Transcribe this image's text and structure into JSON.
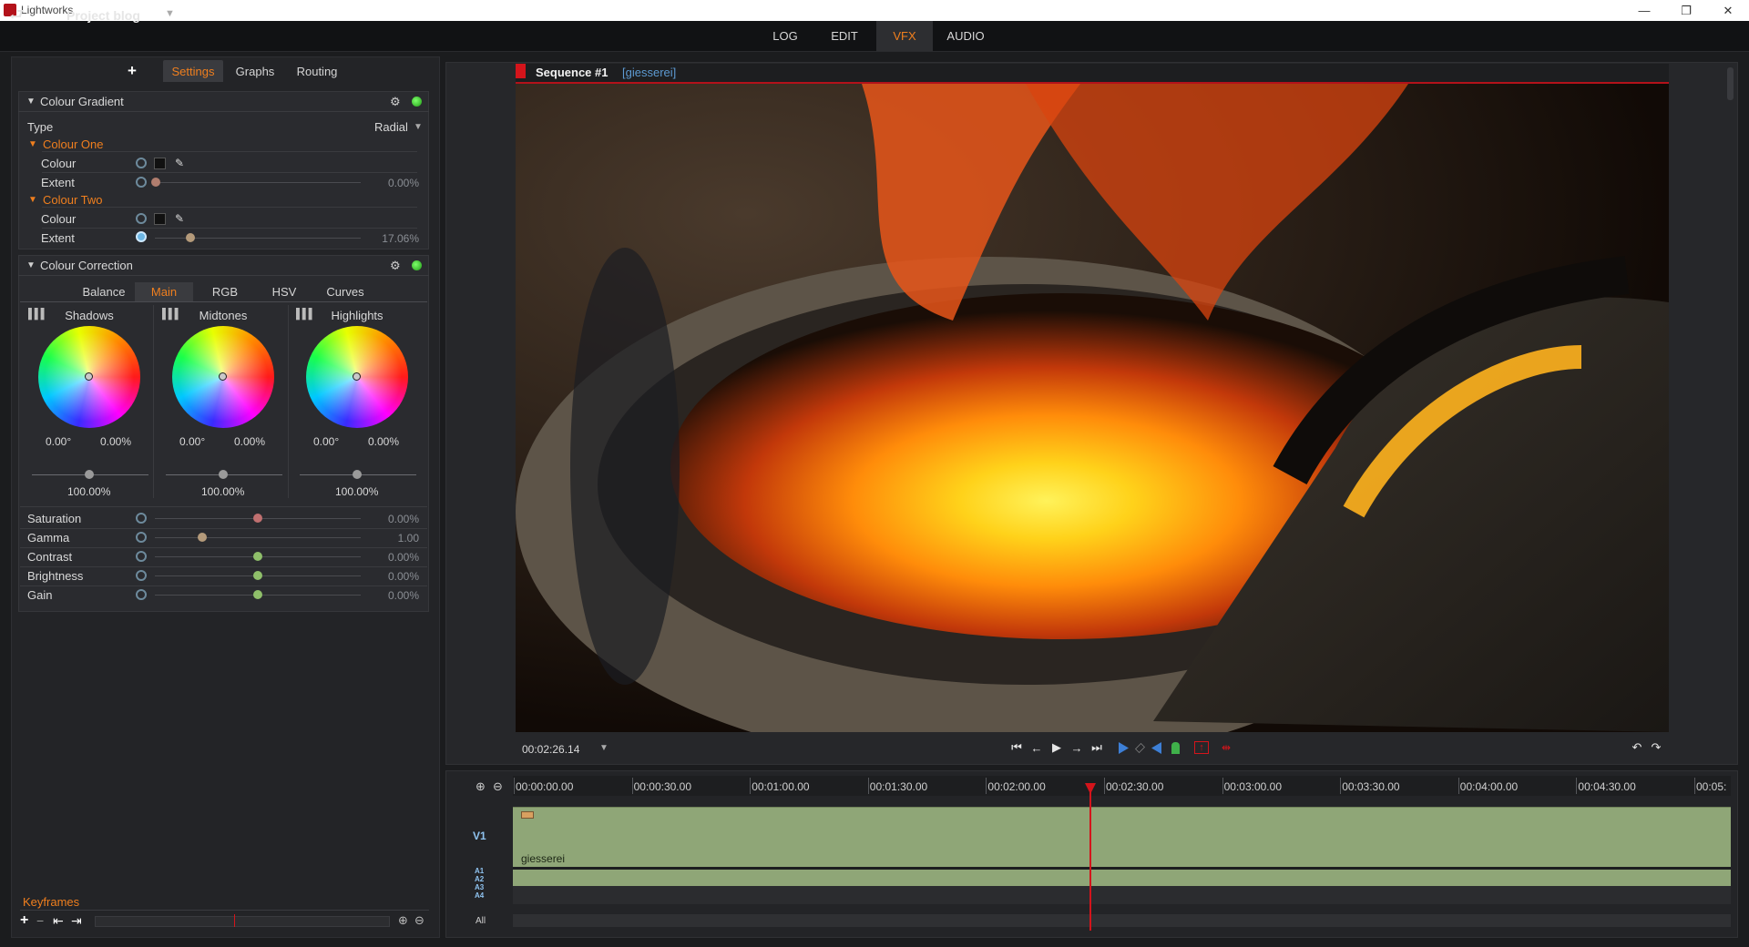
{
  "os": {
    "app_name": "Lightworks",
    "min": "—",
    "max": "❐",
    "close": "✕"
  },
  "header": {
    "project_title": "Project blog",
    "project_dropdown": "▼",
    "exit_icon": "⮐",
    "rooms": [
      "LOG",
      "EDIT",
      "VFX",
      "AUDIO"
    ],
    "active_room": "VFX"
  },
  "panel": {
    "add": "+",
    "tabs": [
      "Settings",
      "Graphs",
      "Routing"
    ],
    "active_tab": "Settings"
  },
  "gradient": {
    "title": "Colour Gradient",
    "type_label": "Type",
    "type_value": "Radial",
    "type_dd": "▼",
    "one": {
      "title": "Colour One",
      "colour_label": "Colour",
      "extent_label": "Extent",
      "extent_value": "0.00%",
      "extent_level": 0.0
    },
    "two": {
      "title": "Colour Two",
      "colour_label": "Colour",
      "extent_label": "Extent",
      "extent_value": "17.06%",
      "extent_level": 0.1706
    }
  },
  "correction": {
    "title": "Colour Correction",
    "tabs": [
      "Balance",
      "Main",
      "RGB",
      "HSV",
      "Curves"
    ],
    "active_tab": "Main",
    "wheels": [
      {
        "label": "Shadows",
        "angle": "0.00°",
        "amount": "0.00%",
        "level": "100.00%"
      },
      {
        "label": "Midtones",
        "angle": "0.00°",
        "amount": "0.00%",
        "level": "100.00%"
      },
      {
        "label": "Highlights",
        "angle": "0.00°",
        "amount": "0.00%",
        "level": "100.00%"
      }
    ],
    "params": [
      {
        "label": "Saturation",
        "value": "0.00%",
        "level": 0.5,
        "color": "#c07070"
      },
      {
        "label": "Gamma",
        "value": "1.00",
        "level": 0.23,
        "color": "#b49a7a"
      },
      {
        "label": "Contrast",
        "value": "0.00%",
        "level": 0.5,
        "color": "#8fbf6a"
      },
      {
        "label": "Brightness",
        "value": "0.00%",
        "level": 0.5,
        "color": "#8fbf6a"
      },
      {
        "label": "Gain",
        "value": "0.00%",
        "level": 0.5,
        "color": "#8fbf6a"
      }
    ]
  },
  "keyframes": {
    "title": "Keyframes",
    "add": "+",
    "remove": "−",
    "prev": "⇤",
    "next": "⇥"
  },
  "viewer": {
    "sequence": "Sequence #1",
    "clip": "[giesserei]",
    "timecode": "00:02:26.14",
    "tc_dd": "▼"
  },
  "transport": {
    "start": "⏮",
    "back": "←",
    "play": "▶",
    "fwd": "→",
    "end": "⏭",
    "undo": "↶",
    "redo": "↷"
  },
  "timeline": {
    "ticks": [
      "00:00:00.00",
      "00:00:30.00",
      "00:01:00.00",
      "00:01:30.00",
      "00:02:00.00",
      "00:02:30.00",
      "00:03:00.00",
      "00:03:30.00",
      "00:04:00.00",
      "00:04:30.00",
      "00:05:"
    ],
    "v1": "V1",
    "audio": [
      "A1",
      "A2",
      "A3",
      "A4"
    ],
    "all": "All",
    "clip_name": "giesserei"
  },
  "colors": {
    "accent": "#f07f1e",
    "record_red": "#d4141b",
    "clip_green": "#8fa677",
    "clip_blue": "#5d9ad2"
  }
}
